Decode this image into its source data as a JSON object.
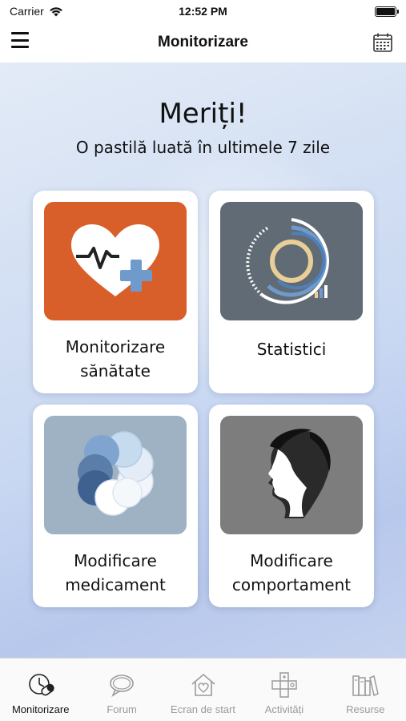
{
  "status_bar": {
    "carrier": "Carrier",
    "time": "12:52 PM"
  },
  "nav": {
    "title": "Monitorizare",
    "menu_icon": "hamburger-icon",
    "calendar_icon": "calendar-icon"
  },
  "main": {
    "headline": "Meriți!",
    "subline": "O pastilă luată în ultimele 7 zile",
    "cards": [
      {
        "label": "Monitorizare\nsănătate",
        "icon": "heart-health-icon",
        "tile_color": "#d95f2a"
      },
      {
        "label": "Statistici",
        "icon": "statistics-ring-icon",
        "tile_color": "#616b75"
      },
      {
        "label": "Modificare\nmedicament",
        "icon": "pills-circles-icon",
        "tile_color": "#9fb2c4"
      },
      {
        "label": "Modificare\ncomportament",
        "icon": "head-profile-icon",
        "tile_color": "#7d7d7d"
      }
    ]
  },
  "tabs": [
    {
      "label": "Monitorizare",
      "icon": "monitor-pill-icon",
      "active": true
    },
    {
      "label": "Forum",
      "icon": "chat-bubble-icon",
      "active": false
    },
    {
      "label": "Ecran de start",
      "icon": "home-heart-icon",
      "active": false
    },
    {
      "label": "Activități",
      "icon": "gamepad-icon",
      "active": false
    },
    {
      "label": "Resurse",
      "icon": "books-icon",
      "active": false
    }
  ]
}
